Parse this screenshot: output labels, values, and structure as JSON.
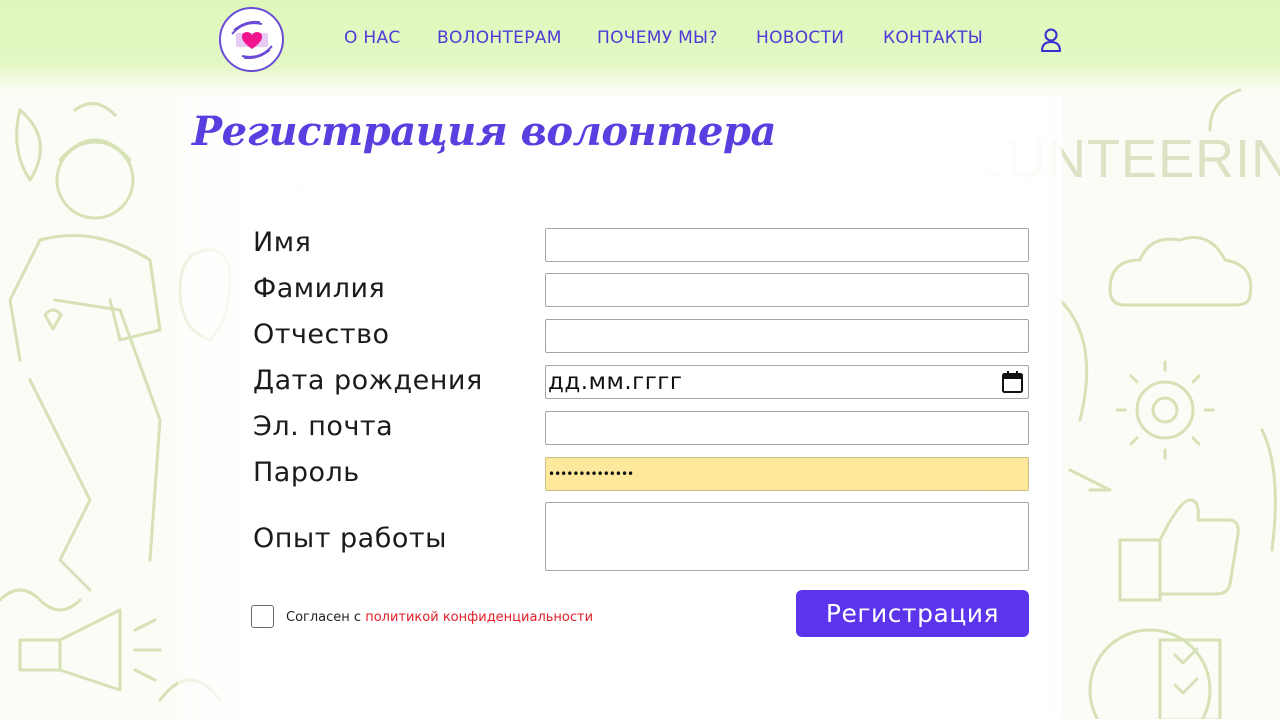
{
  "nav": {
    "items": [
      {
        "label": "О НАС"
      },
      {
        "label": "ВОЛОНТЕРАМ"
      },
      {
        "label": "ПОЧЕМУ МЫ?"
      },
      {
        "label": "НОВОСТИ"
      },
      {
        "label": "КОНТАКТЫ"
      }
    ],
    "logo_icon": "heart-hands-logo",
    "user_icon": "user-icon"
  },
  "background": {
    "word": "VOLUNTEERING"
  },
  "form": {
    "title": "Регистрация волонтера",
    "fields": [
      {
        "label": "Имя",
        "value": ""
      },
      {
        "label": "Фамилия",
        "value": ""
      },
      {
        "label": "Отчество",
        "value": ""
      },
      {
        "label": "Дата рождения",
        "value": "дд.мм.гггг"
      },
      {
        "label": "Эл. почта",
        "value": ""
      },
      {
        "label": "Пароль",
        "value": "••••••••••••••"
      },
      {
        "label": "Опыт работы",
        "value": ""
      }
    ],
    "agree_text": "Согласен с ",
    "agree_link": "политикой конфиденциальности",
    "submit_label": "Регистрация"
  },
  "colors": {
    "accent": "#5b34ec",
    "nav_text": "#4f3ad6",
    "header_bg": "#dff7bb",
    "link_red": "#e0202a",
    "autofill_yellow": "#fde89b"
  }
}
